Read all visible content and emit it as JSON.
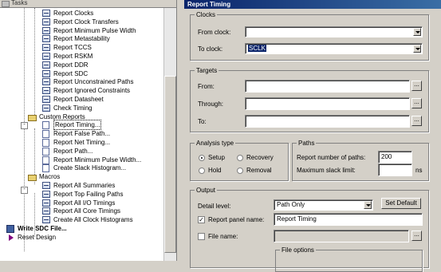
{
  "left_panel": {
    "title": "Tasks",
    "items": [
      {
        "label": "Report Clocks",
        "icon": "report-icon"
      },
      {
        "label": "Report Clock Transfers",
        "icon": "report-icon"
      },
      {
        "label": "Report Minimum Pulse Width",
        "icon": "report-icon"
      },
      {
        "label": "Report Metastability",
        "icon": "report-icon"
      },
      {
        "label": "Report TCCS",
        "icon": "report-icon"
      },
      {
        "label": "Report RSKM",
        "icon": "report-icon"
      },
      {
        "label": "Report DDR",
        "icon": "report-icon"
      },
      {
        "label": "Report SDC",
        "icon": "report-icon"
      },
      {
        "label": "Report Unconstrained Paths",
        "icon": "report-icon"
      },
      {
        "label": "Report Ignored Constraints",
        "icon": "report-icon"
      },
      {
        "label": "Report Datasheet",
        "icon": "report-icon"
      },
      {
        "label": "Check Timing",
        "icon": "report-icon"
      },
      {
        "label": "Custom Reports",
        "icon": "folder-icon"
      },
      {
        "label": "Report Timing...",
        "icon": "doc-icon"
      },
      {
        "label": "Report False Path...",
        "icon": "doc-icon"
      },
      {
        "label": "Report Net Timing...",
        "icon": "doc-icon"
      },
      {
        "label": "Report Path...",
        "icon": "doc-icon"
      },
      {
        "label": "Report Minimum Pulse Width...",
        "icon": "doc-icon"
      },
      {
        "label": "Create Slack Histogram...",
        "icon": "doc-icon"
      },
      {
        "label": "Macros",
        "icon": "folder-icon"
      },
      {
        "label": "Report All Summaries",
        "icon": "report-icon"
      },
      {
        "label": "Report Top Failing Paths",
        "icon": "report-icon"
      },
      {
        "label": "Report All I/O Timings",
        "icon": "report-icon"
      },
      {
        "label": "Report All Core Timings",
        "icon": "report-icon"
      },
      {
        "label": "Create All Clock Histograms",
        "icon": "report-icon"
      },
      {
        "label": "Write SDC File...",
        "icon": "write-sdc-icon"
      },
      {
        "label": "Reset Design",
        "icon": "reset-icon"
      }
    ],
    "expanders": [
      "-",
      "-"
    ]
  },
  "dialog": {
    "title": "Report Timing",
    "clocks": {
      "legend": "Clocks",
      "from_label": "From clock:",
      "from_value": "",
      "to_label": "To clock:",
      "to_value": "SCLK"
    },
    "targets": {
      "legend": "Targets",
      "from_label": "From:",
      "through_label": "Through:",
      "to_label": "To:",
      "browse_label": "..."
    },
    "analysis": {
      "legend": "Analysis type",
      "setup": "Setup",
      "hold": "Hold",
      "recovery": "Recovery",
      "removal": "Removal",
      "selected": "Setup"
    },
    "paths": {
      "legend": "Paths",
      "num_label": "Report number of paths:",
      "num_value": "200",
      "slack_label": "Maximum slack limit:",
      "slack_value": "",
      "slack_unit": "ns"
    },
    "output": {
      "legend": "Output",
      "detail_label": "Detail level:",
      "detail_value": "Path Only",
      "set_default": "Set Default",
      "panel_name_label": "Report panel name:",
      "panel_name_checked": true,
      "panel_name_value": "Report Timing",
      "file_name_label": "File name:",
      "file_name_checked": false,
      "file_name_value": "",
      "file_options_legend": "File options",
      "check_mark": "✓"
    }
  }
}
